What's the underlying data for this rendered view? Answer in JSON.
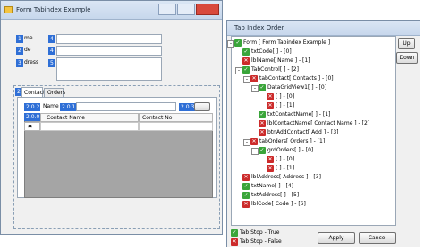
{
  "form": {
    "title": "Form Tabindex Example",
    "labels": [
      "me",
      "de",
      "dress"
    ],
    "label_badges": [
      "1",
      "2",
      "3"
    ],
    "field_badges": [
      "4",
      "4",
      "5"
    ],
    "tabs": [
      "Contacts",
      "Orders"
    ],
    "tab_badge": "2",
    "name_label": "Name",
    "badges": {
      "b200": "2.0.0",
      "b201": "2.0.1",
      "b202": "2.0.2",
      "b203": "2.0.3"
    },
    "grid": {
      "columns": [
        "Contact Name",
        "Contact No"
      ],
      "row_marker": "✱"
    }
  },
  "tab_index_window": {
    "title": "Tab Index Order",
    "buttons": {
      "up": "Up",
      "down": "Down",
      "apply": "Apply",
      "cancel": "Cancel"
    },
    "tree": [
      {
        "label": "Form [ Form Tabindex Example ]",
        "state": "on",
        "depth": 0,
        "expander": "-"
      },
      {
        "label": "txtCode[ ] - [0]",
        "state": "on",
        "depth": 1,
        "expander": ""
      },
      {
        "label": "lblName[ Name ] - [1]",
        "state": "off",
        "depth": 1,
        "expander": ""
      },
      {
        "label": "TabControl[ ] - [2]",
        "state": "on",
        "depth": 1,
        "expander": "-"
      },
      {
        "label": "tabContact[ Contacts ] - [0]",
        "state": "off",
        "depth": 2,
        "expander": "-"
      },
      {
        "label": "DataGridView1[ ] - [0]",
        "state": "on",
        "depth": 3,
        "expander": "-"
      },
      {
        "label": "[ ] - [0]",
        "state": "off",
        "depth": 4,
        "expander": ""
      },
      {
        "label": "[ ] - [1]",
        "state": "off",
        "depth": 4,
        "expander": ""
      },
      {
        "label": "txtContactName[ ] - [1]",
        "state": "on",
        "depth": 3,
        "expander": ""
      },
      {
        "label": "lblContactName[ Contact Name ] - [2]",
        "state": "off",
        "depth": 3,
        "expander": ""
      },
      {
        "label": "btnAddContact[ Add ] - [3]",
        "state": "off",
        "depth": 3,
        "expander": ""
      },
      {
        "label": "tabOrders[ Orders ] - [1]",
        "state": "off",
        "depth": 2,
        "expander": "-"
      },
      {
        "label": "grdOrders[ ] - [0]",
        "state": "on",
        "depth": 3,
        "expander": "-"
      },
      {
        "label": "[ ] - [0]",
        "state": "off",
        "depth": 4,
        "expander": ""
      },
      {
        "label": "[ ] - [1]",
        "state": "off",
        "depth": 4,
        "expander": ""
      },
      {
        "label": "lblAddress[ Address ] - [3]",
        "state": "off",
        "depth": 1,
        "expander": ""
      },
      {
        "label": "txtName[ ] - [4]",
        "state": "on",
        "depth": 1,
        "expander": ""
      },
      {
        "label": "txtAddress[ ] - [5]",
        "state": "on",
        "depth": 1,
        "expander": ""
      },
      {
        "label": "lblCode[ Code ] - [6]",
        "state": "off",
        "depth": 1,
        "expander": ""
      }
    ],
    "legend": [
      {
        "label": "Tab Stop - True",
        "state": "on"
      },
      {
        "label": "Tab Stop - False",
        "state": "off"
      }
    ]
  },
  "colors": {
    "badge_blue": "#2f6fd6",
    "tabstop_true": "#3aa53a",
    "tabstop_false": "#cc2b2b"
  }
}
